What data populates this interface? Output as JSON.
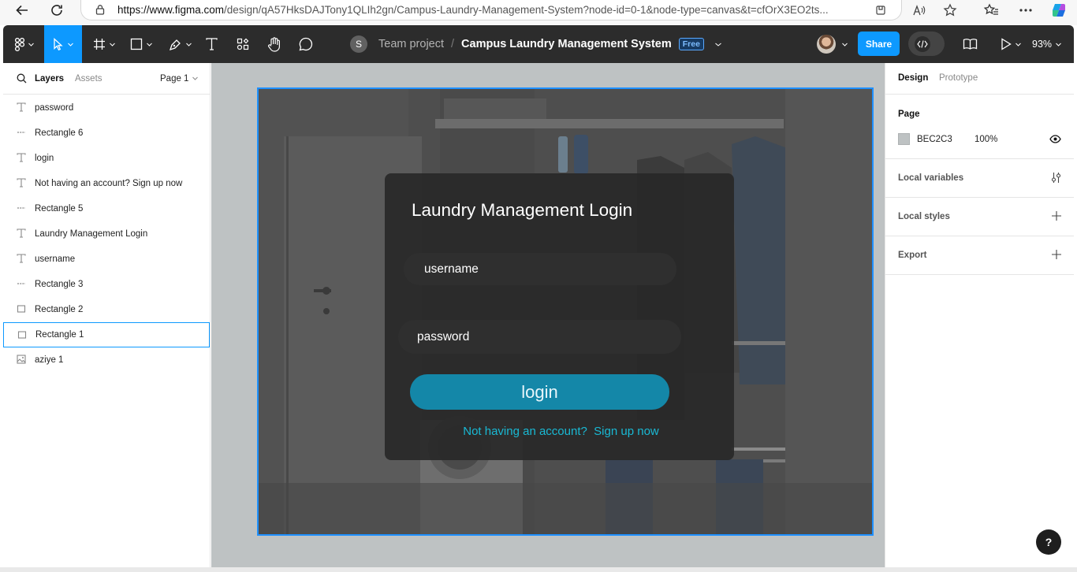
{
  "browser": {
    "url_host": "https://www.figma.com",
    "url_path": "/design/qA57HksDAJTony1QLIh2gn/Campus-Laundry-Management-System?node-id=0-1&node-type=canvas&t=cfOrX3EO2ts..."
  },
  "toolbar": {
    "team_initial": "S",
    "team": "Team project",
    "slash": "/",
    "file_name": "Campus Laundry Management System",
    "plan_badge": "Free",
    "share_label": "Share",
    "zoom": "93%",
    "icons": [
      "figma-menu-icon",
      "move-icon",
      "frame-icon",
      "rectangle-icon",
      "pen-icon",
      "text-icon",
      "resources-icon",
      "hand-icon",
      "comment-icon",
      "dev-mode-icon",
      "library-icon",
      "present-icon"
    ]
  },
  "left_panel": {
    "tab_layers": "Layers",
    "tab_assets": "Assets",
    "page_select": "Page 1",
    "layers": [
      {
        "name": "password",
        "type": "text"
      },
      {
        "name": "Rectangle 6",
        "type": "line"
      },
      {
        "name": "login",
        "type": "text"
      },
      {
        "name": "Not having an account? Sign up now",
        "type": "text"
      },
      {
        "name": "Rectangle 5",
        "type": "line"
      },
      {
        "name": "Laundry Management Login",
        "type": "text"
      },
      {
        "name": "username",
        "type": "text"
      },
      {
        "name": "Rectangle 3",
        "type": "line"
      },
      {
        "name": "Rectangle 2",
        "type": "rect"
      },
      {
        "name": "Rectangle 1",
        "type": "rect",
        "selected": true
      },
      {
        "name": "aziye 1",
        "type": "image"
      }
    ]
  },
  "canvas": {
    "background": "#BEC2C3",
    "selection_color": "#1E90FF",
    "login": {
      "title": "Laundry Management Login",
      "username_placeholder": "username",
      "password_placeholder": "password",
      "login_label": "login",
      "signup_text": "Not having an account?  Sign up now",
      "button_color": "#1487A8",
      "link_color": "#19B9D4"
    }
  },
  "right_panel": {
    "tab_design": "Design",
    "tab_prototype": "Prototype",
    "page_heading": "Page",
    "page_color": "BEC2C3",
    "page_opacity": "100%",
    "local_variables": "Local variables",
    "local_styles": "Local styles",
    "export": "Export"
  },
  "help": "?"
}
